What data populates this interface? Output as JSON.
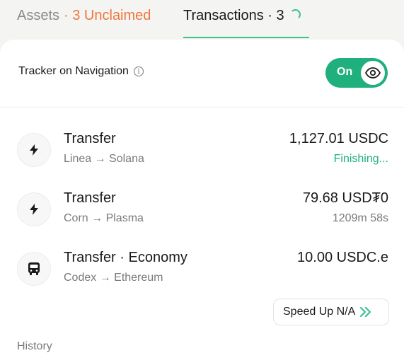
{
  "tabs": {
    "assets_label": "Assets",
    "assets_unclaimed": "· 3 Unclaimed",
    "transactions_label": "Transactions · 3"
  },
  "tracker": {
    "label": "Tracker on Navigation",
    "info_glyph": "i",
    "toggle_label": "On",
    "toggle_state": true
  },
  "transactions": [
    {
      "title": "Transfer",
      "route": "Linea → Solana",
      "amount": "1,127.01 USDC",
      "status": "Finishing...",
      "icon": "lightning-icon"
    },
    {
      "title": "Transfer",
      "route": "Corn → Plasma",
      "amount": "79.68 USD₮0",
      "status": "1209m 58s",
      "icon": "lightning-icon"
    },
    {
      "title": "Transfer · Economy",
      "route": "Codex → Ethereum",
      "amount": "10.00 USDC.e",
      "status": "",
      "icon": "bus-icon"
    }
  ],
  "speed_up": {
    "label": "Speed Up N/A"
  },
  "history_label": "History",
  "colors": {
    "accent_green": "#1fb07d",
    "unclaimed_orange": "#f0763a"
  }
}
